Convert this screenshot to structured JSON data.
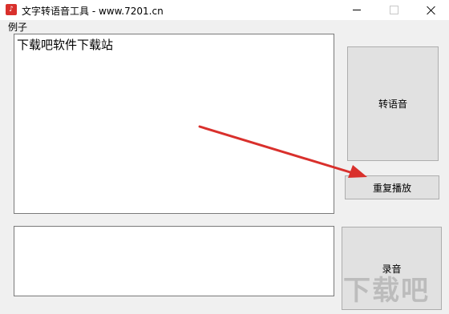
{
  "window": {
    "title": "文字转语音工具 - www.7201.cn",
    "icon": "app-icon"
  },
  "menu": {
    "label": "例子"
  },
  "main_text": {
    "value": "下载吧软件下载站"
  },
  "secondary_text": {
    "value": ""
  },
  "buttons": {
    "convert_label": "转语音",
    "replay_label": "重复播放",
    "record_label": "录音"
  },
  "watermark": {
    "text": "下载吧"
  },
  "colors": {
    "arrow": "#d9302c",
    "app_icon": "#d9302c"
  }
}
